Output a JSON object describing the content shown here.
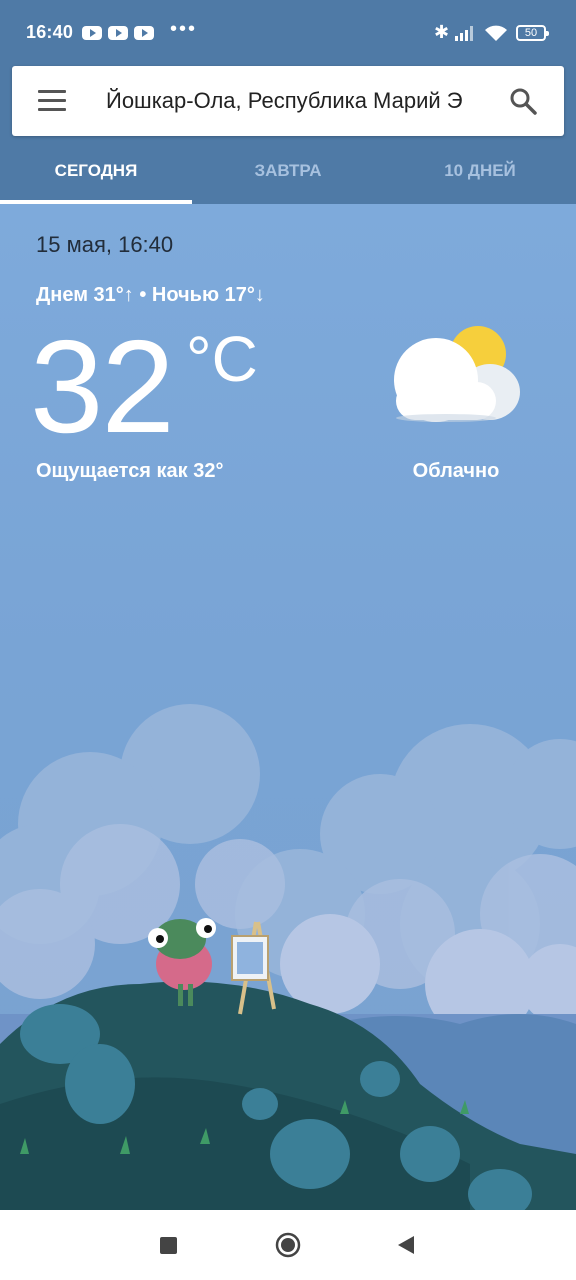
{
  "status_bar": {
    "time": "16:40",
    "notification_icons": [
      "youtube-icon",
      "youtube-icon",
      "youtube-icon"
    ],
    "more": "•••",
    "battery": "50"
  },
  "header": {
    "location": "Йошкар-Ола, Республика Марий Э",
    "tabs": [
      {
        "label": "СЕГОДНЯ",
        "active": true
      },
      {
        "label": "ЗАВТРА",
        "active": false
      },
      {
        "label": "10 ДНЕЙ",
        "active": false
      }
    ]
  },
  "weather": {
    "date": "15 мая, 16:40",
    "high_low": "Днем 31°↑ • Ночью 17°↓",
    "temperature": "32",
    "unit": "°C",
    "feels_like": "Ощущается как 32°",
    "condition": "Облачно",
    "condition_icon": "partly-cloudy-icon"
  },
  "colors": {
    "header_bg": "#4f7aa6",
    "sky": "#7eaadb",
    "sun": "#f6cf3c"
  }
}
